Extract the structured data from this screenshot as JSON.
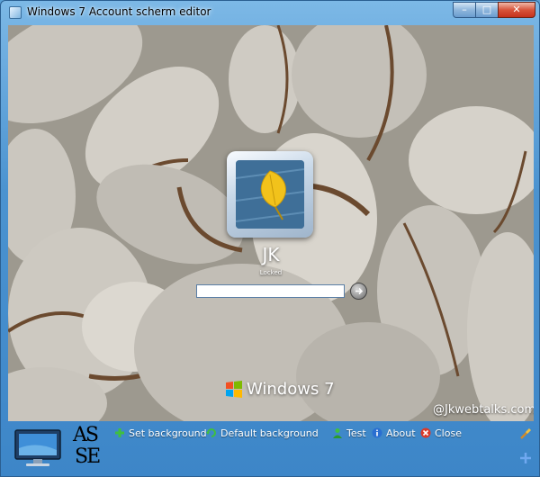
{
  "window": {
    "title": "Windows 7 Account scherm editor",
    "controls": {
      "minimize": "–",
      "maximize": "□",
      "close": "✕"
    }
  },
  "login": {
    "username": "JK",
    "status": "Locked",
    "password_value": ""
  },
  "branding": {
    "logo_text": "Windows 7",
    "watermark": "@Jkwebtalks.com"
  },
  "toolbar": {
    "items": [
      {
        "label": "Set background",
        "icon": "plus-icon"
      },
      {
        "label": "Default background",
        "icon": "refresh-icon"
      },
      {
        "label": "Test",
        "icon": "user-icon"
      },
      {
        "label": "About",
        "icon": "info-icon"
      },
      {
        "label": "Close",
        "icon": "close-icon"
      }
    ],
    "ase_logo": {
      "top": "AS",
      "bottom": "SE"
    }
  },
  "colors": {
    "accent": "#3d86c8",
    "close_button": "#c4321c",
    "leaf": "#f2c21b"
  }
}
